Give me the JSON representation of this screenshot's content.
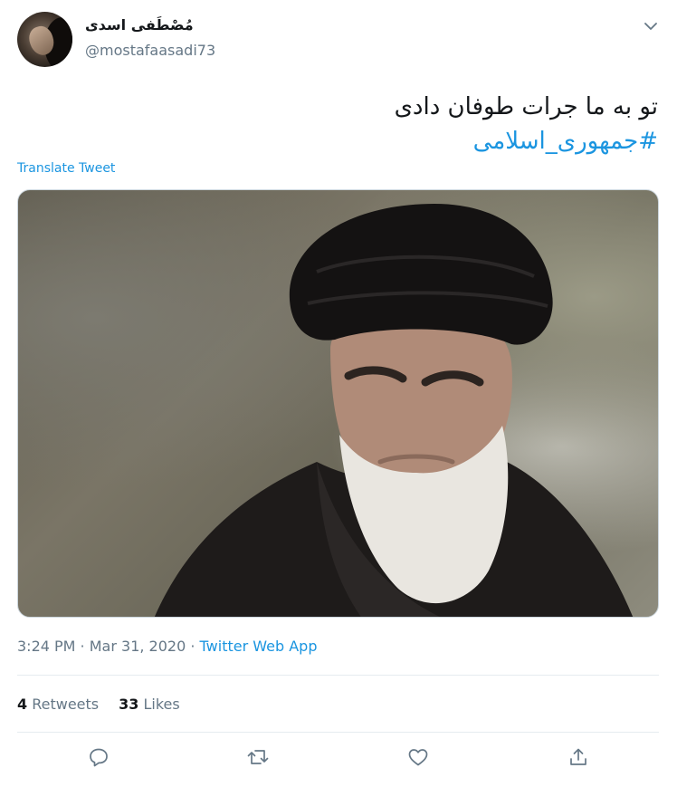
{
  "author": {
    "display_name": "مُصْطَفی اسدی",
    "handle": "@mostafaasadi73",
    "avatar_icon": "user-avatar"
  },
  "tweet": {
    "text_line1": "تو به ما جرات طوفان دادی",
    "hashtag": "#جمهوری_اسلامی",
    "translate_label": "Translate Tweet",
    "time": "3:24 PM",
    "separator": " · ",
    "date": "Mar 31, 2020",
    "source": "Twitter Web App"
  },
  "stats": {
    "retweets_count": "4",
    "retweets_label": "Retweets",
    "likes_count": "33",
    "likes_label": "Likes"
  },
  "actions": [
    "reply-icon",
    "retweet-icon",
    "like-icon",
    "share-icon"
  ],
  "colors": {
    "link": "#1b95e0",
    "secondary_text": "#657786",
    "primary_text": "#14171a",
    "divider": "#e6ecf0"
  }
}
